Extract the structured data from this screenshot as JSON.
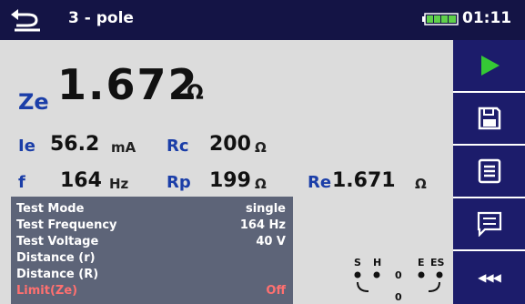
{
  "header": {
    "title": "3 - pole",
    "time": "01:11"
  },
  "main_result": {
    "label": "Ze",
    "value": "1.672",
    "unit": "Ω"
  },
  "sub_results": {
    "ie": {
      "label": "Ie",
      "value": "56.2",
      "unit": "mA"
    },
    "rc": {
      "label": "Rc",
      "value": "200",
      "unit": "Ω"
    },
    "f": {
      "label": "f",
      "value": "164",
      "unit": "Hz"
    },
    "rp": {
      "label": "Rp",
      "value": "199",
      "unit": "Ω"
    },
    "re": {
      "label": "Re",
      "value": "1.671",
      "unit": "Ω"
    }
  },
  "params": [
    {
      "key": "Test Mode",
      "value": "single"
    },
    {
      "key": "Test Frequency",
      "value": "164 Hz"
    },
    {
      "key": "Test Voltage",
      "value": "40 V"
    },
    {
      "key": "Distance (r)",
      "value": ""
    },
    {
      "key": "Distance (R)",
      "value": ""
    },
    {
      "key": "Limit(Ze)",
      "value": "Off"
    }
  ],
  "diagram": {
    "labels": [
      "S",
      "H",
      "E",
      "ES"
    ],
    "zero_a": "0",
    "zero_b": "0"
  },
  "sidebar": {
    "more_label": "◀◀◀"
  },
  "colors": {
    "accent_blue": "#1b3ea8",
    "start_green": "#35c935",
    "limit_red": "#ff7070",
    "sidebar": "#1c1c6b"
  }
}
